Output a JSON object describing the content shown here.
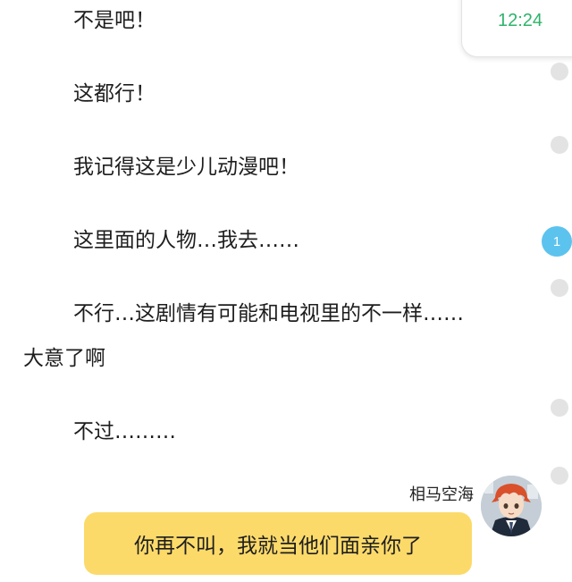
{
  "status": {
    "time": "12:24"
  },
  "story": {
    "lines": [
      "不是吧！",
      "这都行！",
      "我记得这是少儿动漫吧！",
      "这里面的人物…我去……",
      "不行…这剧情有可能和电视里的不一样……",
      "大意了啊",
      "不过………"
    ]
  },
  "page_indicator": {
    "active_label": "1"
  },
  "chat": {
    "speaker_name": "相马空海",
    "message": "你再不叫，我就当他们面亲你了"
  },
  "colors": {
    "accent_green": "#2fb36b",
    "indicator_active": "#5cc3ee",
    "bubble": "#fcda6a"
  }
}
